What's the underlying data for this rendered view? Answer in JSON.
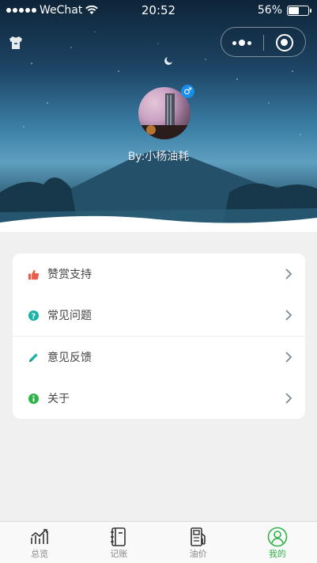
{
  "status_bar": {
    "carrier": "WeChat",
    "time": "20:52",
    "battery_percent": "56%",
    "battery_level": 0.56
  },
  "profile": {
    "nickname": "By:小杨油耗",
    "gender_symbol": "♂"
  },
  "menu": [
    {
      "icon": "thumbs-up-icon",
      "label": "赞赏支持",
      "icon_color": "#e85c4a"
    },
    {
      "icon": "question-icon",
      "label": "常见问题",
      "icon_color": "#1cb2a8"
    },
    {
      "icon": "pencil-icon",
      "label": "意见反馈",
      "icon_color": "#1cb2a8"
    },
    {
      "icon": "info-icon",
      "label": "关于",
      "icon_color": "#2fb34a"
    }
  ],
  "tabs": [
    {
      "icon": "chart-icon",
      "label": "总览"
    },
    {
      "icon": "notebook-icon",
      "label": "记账"
    },
    {
      "icon": "fuel-pump-icon",
      "label": "油价"
    },
    {
      "icon": "user-icon",
      "label": "我的",
      "active": true
    }
  ],
  "colors": {
    "accent": "#2fb34a",
    "tab_inactive": "#888888"
  }
}
